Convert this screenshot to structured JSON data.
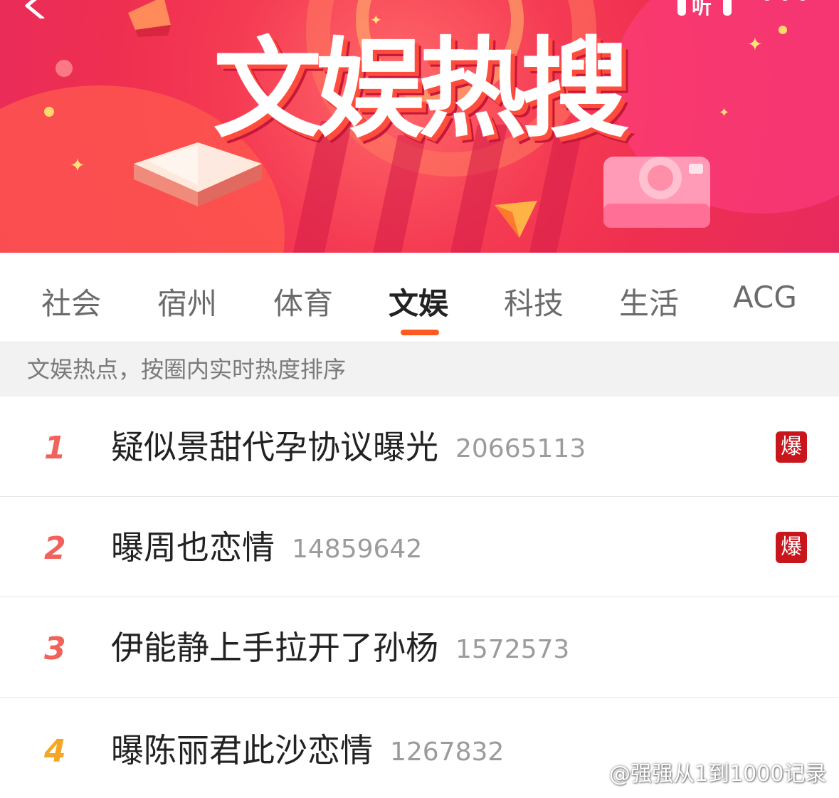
{
  "banner": {
    "title": "文娱热搜",
    "listen_label": "听",
    "colors": {
      "primary": "#ef2f50",
      "accent": "#ff5a1f"
    }
  },
  "tabs": [
    {
      "label": "社会",
      "active": false
    },
    {
      "label": "宿州",
      "active": false
    },
    {
      "label": "体育",
      "active": false
    },
    {
      "label": "文娱",
      "active": true
    },
    {
      "label": "科技",
      "active": false
    },
    {
      "label": "生活",
      "active": false
    },
    {
      "label": "ACG",
      "active": false
    }
  ],
  "subtitle": "文娱热点，按圈内实时热度排序",
  "list": [
    {
      "rank": "1",
      "title": "疑似景甜代孕协议曝光",
      "count": "20665113",
      "badge": "爆"
    },
    {
      "rank": "2",
      "title": "曝周也恋情",
      "count": "14859642",
      "badge": "爆"
    },
    {
      "rank": "3",
      "title": "伊能静上手拉开了孙杨",
      "count": "1572573",
      "badge": ""
    },
    {
      "rank": "4",
      "title": "曝陈丽君此沙恋情",
      "count": "1267832",
      "badge": ""
    }
  ],
  "watermark": "@强强从1到1000记录",
  "icons": [
    "back-arrow-icon",
    "listen-icon",
    "more-icon",
    "book-icon",
    "camera-icon",
    "weibo-icon"
  ]
}
